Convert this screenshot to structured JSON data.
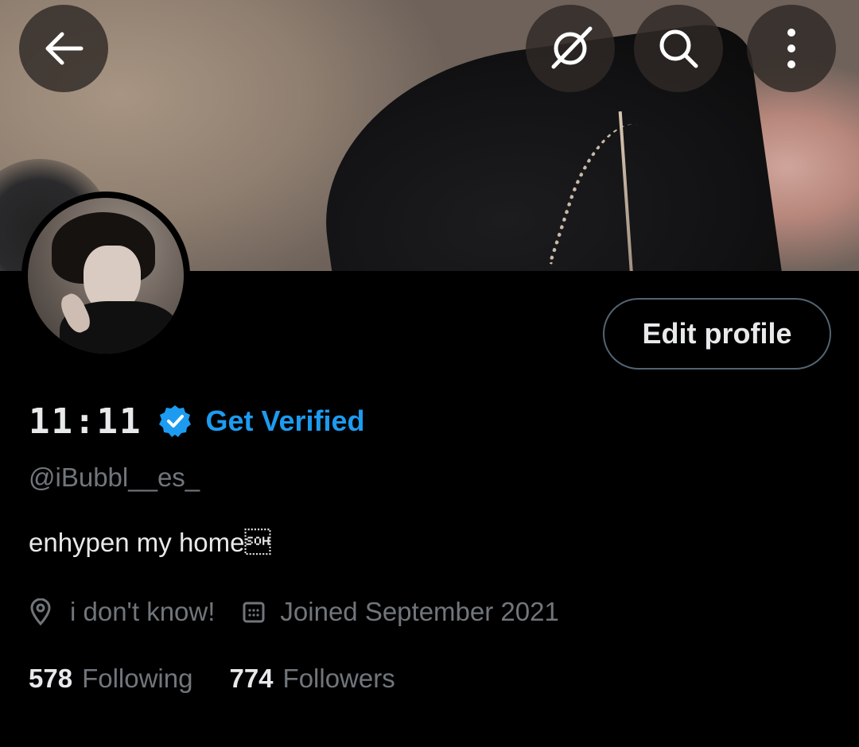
{
  "header": {
    "back_icon": "arrow-left-icon",
    "grok_icon": "grok-slash-icon",
    "search_icon": "search-icon",
    "more_icon": "more-vertical-icon"
  },
  "profile": {
    "display_name": "11:11",
    "verified_badge_icon": "verified-badge-icon",
    "get_verified_label": "Get Verified",
    "handle": "@iBubbl__es_",
    "bio": "enhypen my home\u0001",
    "location": "i don't know!",
    "location_icon": "location-pin-icon",
    "joined": "Joined September 2021",
    "calendar_icon": "calendar-icon",
    "following_count": "578",
    "following_label": "Following",
    "followers_count": "774",
    "followers_label": "Followers"
  },
  "actions": {
    "edit_profile_label": "Edit profile"
  },
  "colors": {
    "background": "#000000",
    "text_primary": "#e7e9ea",
    "text_secondary": "#71767b",
    "accent_blue": "#1d9bf0",
    "button_border": "#536471"
  }
}
